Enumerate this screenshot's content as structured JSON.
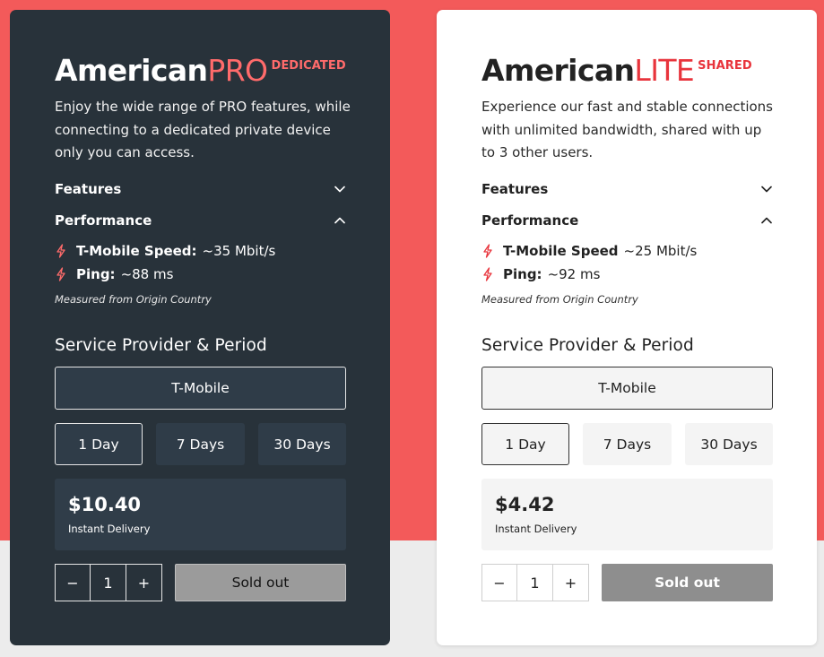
{
  "colors": {
    "background_accent": "#f35a5a",
    "pro_card": "#28323a",
    "lite_card": "#ffffff",
    "pro_accent": "#ff6b6b",
    "lite_accent": "#e8343c"
  },
  "pro": {
    "brand": "American",
    "tier": "PRO",
    "kind": "DEDICATED",
    "description": "Enjoy the wide range of PRO features, while connecting to a dedicated private device only you can access.",
    "features_label": "Features",
    "features_icon": "chevron-down-icon",
    "performance_label": "Performance",
    "performance_icon": "chevron-up-icon",
    "speed_key": "T-Mobile Speed:",
    "speed_value": "~35 Mbit/s",
    "ping_key": "Ping:",
    "ping_value": "~88 ms",
    "measured": "Measured from Origin Country",
    "section_title": "Service Provider & Period",
    "provider": "T-Mobile",
    "periods": [
      "1 Day",
      "7 Days",
      "30 Days"
    ],
    "selected_period": "1 Day",
    "price": "$10.40",
    "delivery": "Instant Delivery",
    "qty_minus": "−",
    "qty_value": "1",
    "qty_plus": "+",
    "cta": "Sold out"
  },
  "lite": {
    "brand": "American",
    "tier": "LITE",
    "kind": "SHARED",
    "description": "Experience our fast and stable connections with unlimited bandwidth, shared with up to 3 other users.",
    "features_label": "Features",
    "features_icon": "chevron-down-icon",
    "performance_label": "Performance",
    "performance_icon": "chevron-up-icon",
    "speed_key": "T-Mobile Speed",
    "speed_value": "~25 Mbit/s",
    "ping_key": "Ping:",
    "ping_value": "~92 ms",
    "measured": "Measured from Origin Country",
    "section_title": "Service Provider & Period",
    "provider": "T-Mobile",
    "periods": [
      "1 Day",
      "7 Days",
      "30 Days"
    ],
    "selected_period": "1 Day",
    "price": "$4.42",
    "delivery": "Instant Delivery",
    "qty_minus": "−",
    "qty_value": "1",
    "qty_plus": "+",
    "cta": "Sold out"
  }
}
